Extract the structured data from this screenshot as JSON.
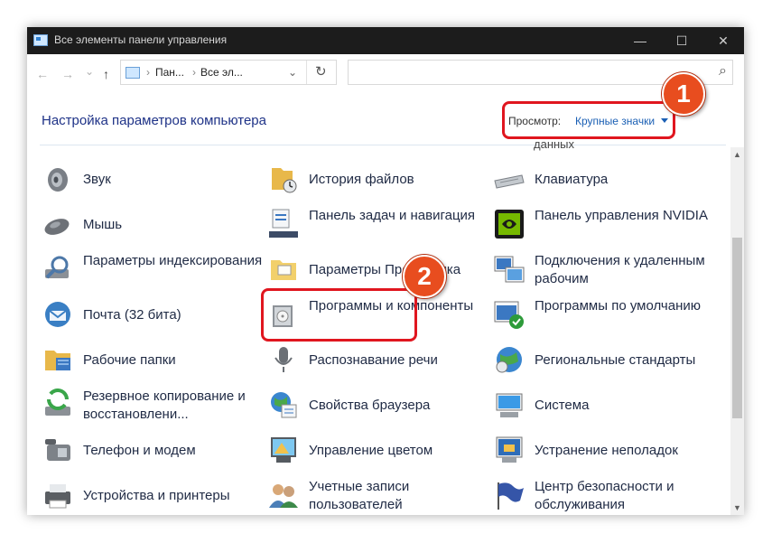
{
  "window": {
    "title": "Все элементы панели управления",
    "controls": {
      "minimize": "—",
      "maximize": "☐",
      "close": "✕"
    }
  },
  "navigation": {
    "back": "←",
    "forward": "→",
    "recent": "⌄",
    "up": "↑",
    "breadcrumb": [
      "Пан...",
      "Все эл..."
    ],
    "refresh": "↻",
    "search_icon": "⌕"
  },
  "header": {
    "title": "Настройка параметров компьютера",
    "view_label": "Просмотр:",
    "view_value": "Крупные значки"
  },
  "partial_text": "данных",
  "items": [
    [
      {
        "label": "Звук",
        "icon": "speaker-icon"
      },
      {
        "label": "Мышь",
        "icon": "mouse-icon"
      },
      {
        "label": "Параметры индексирования",
        "icon": "indexing-icon"
      },
      {
        "label": "Почта (32 бита)",
        "icon": "mail-icon"
      },
      {
        "label": "Рабочие папки",
        "icon": "work-folders-icon"
      },
      {
        "label": "Резервное копирование и восстановлени...",
        "icon": "backup-icon"
      },
      {
        "label": "Телефон и модем",
        "icon": "phone-icon"
      },
      {
        "label": "Устройства и принтеры",
        "icon": "printer-icon"
      }
    ],
    [
      {
        "label": "История файлов",
        "icon": "file-history-icon"
      },
      {
        "label": "Панель задач и навигация",
        "icon": "taskbar-icon"
      },
      {
        "label": "Параметры Проводника",
        "icon": "explorer-options-icon"
      },
      {
        "label": "Программы и компоненты",
        "icon": "programs-icon"
      },
      {
        "label": "Распознавание речи",
        "icon": "microphone-icon"
      },
      {
        "label": "Свойства браузера",
        "icon": "internet-options-icon"
      },
      {
        "label": "Управление цветом",
        "icon": "color-management-icon"
      },
      {
        "label": "Учетные записи пользователей",
        "icon": "user-accounts-icon"
      }
    ],
    [
      {
        "label": "Клавиатура",
        "icon": "keyboard-icon"
      },
      {
        "label": "Панель управления NVIDIA",
        "icon": "nvidia-icon"
      },
      {
        "label": "Подключения к удаленным рабочим",
        "icon": "remote-desktop-icon"
      },
      {
        "label": "Программы по умолчанию",
        "icon": "default-programs-icon"
      },
      {
        "label": "Региональные стандарты",
        "icon": "region-icon"
      },
      {
        "label": "Система",
        "icon": "system-icon"
      },
      {
        "label": "Устранение неполадок",
        "icon": "troubleshoot-icon"
      },
      {
        "label": "Центр безопасности и обслуживания",
        "icon": "security-flag-icon"
      }
    ]
  ],
  "annotations": {
    "badge1": "1",
    "badge2": "2"
  },
  "colors": {
    "annotation_red": "#e0161f",
    "badge_orange": "#e84d1f",
    "link_blue": "#1a5fb4"
  }
}
